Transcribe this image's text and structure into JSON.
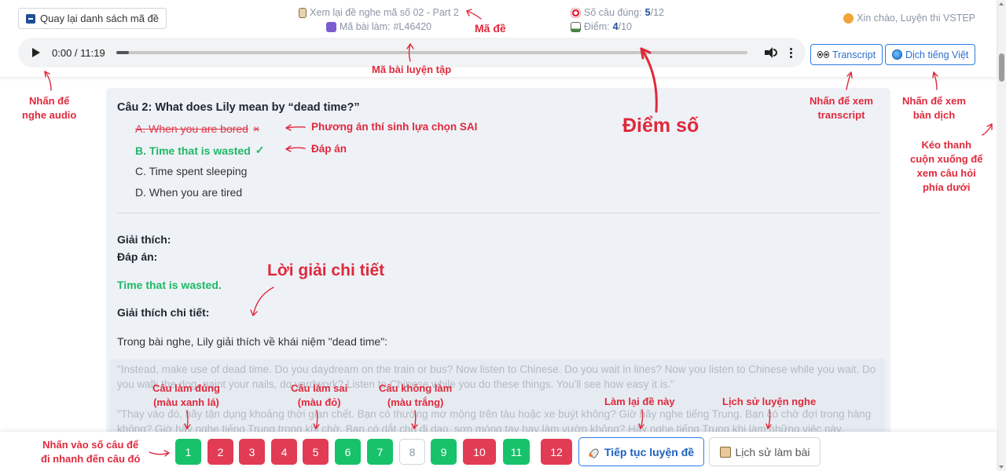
{
  "header": {
    "back_label": "Quay lại danh sách mã đề",
    "exam_title": "Xem lại đề nghe mã số 02 - Part 2",
    "attempt_label": "Mã bài làm:",
    "attempt_code": "#L46420",
    "correct_label": "Số câu đúng:",
    "correct_value": "5",
    "correct_total": "/12",
    "score_label": "Điểm:",
    "score_value": "4",
    "score_total": "/10",
    "greeting": "Xin chào, Luyện thi VSTEP",
    "transcript_label": "Transcript",
    "translate_label": "Dịch tiếng Việt"
  },
  "player": {
    "time": "0:00 / 11:19",
    "progress": 0.02
  },
  "question": {
    "title": "Câu 2: What does Lily mean by “dead time?”",
    "options": [
      {
        "text": "A. When you are bored",
        "status": "wrong"
      },
      {
        "text": "B. Time that is wasted",
        "status": "correct"
      },
      {
        "text": "C. Time spent sleeping",
        "status": "normal"
      },
      {
        "text": "D. When you are tired",
        "status": "normal"
      }
    ],
    "wrong_mark": "×",
    "correct_mark": "✓"
  },
  "explanation": {
    "heading": "Giải thích:",
    "answer_label": "Đáp án:",
    "answer_text": "Time that is wasted.",
    "detail_label": "Giải thích chi tiết:",
    "paragraph": "Trong bài nghe, Lily giải thích về khái niệm \"dead time\":",
    "quote_en": "\"Instead, make use of dead time. Do you daydream on the train or bus? Now listen to Chinese. Do you wait in lines? Now you listen to Chinese while you wait. Do you walk the dog, paint your nails, do yardwork? Listen to Chinese while you do these things. You'll see how easy it is.\"",
    "quote_vi": "\"Thay vào đó, hãy tận dụng khoảng thời gian chết. Bạn có thường mơ mộng trên tàu hoặc xe buýt không? Giờ hãy nghe tiếng Trung. Bạn có chờ đợi trong hàng không? Giờ hãy nghe tiếng Trung trong khi chờ. Bạn có dắt chó đi dạo, sơn móng tay hay làm vườn không? Hãy nghe tiếng Trung khi làm những việc này."
  },
  "bottom": {
    "questions": [
      {
        "n": "1",
        "status": "correct"
      },
      {
        "n": "2",
        "status": "wrong"
      },
      {
        "n": "3",
        "status": "wrong"
      },
      {
        "n": "4",
        "status": "wrong"
      },
      {
        "n": "5",
        "status": "wrong"
      },
      {
        "n": "6",
        "status": "correct"
      },
      {
        "n": "7",
        "status": "correct"
      },
      {
        "n": "8",
        "status": "unanswered"
      },
      {
        "n": "9",
        "status": "correct"
      },
      {
        "n": "10",
        "status": "wrong"
      },
      {
        "n": "11",
        "status": "correct"
      },
      {
        "n": "12",
        "status": "wrong"
      }
    ],
    "continue_label": "Tiếp tục luyện đề",
    "history_label": "Lịch sử làm bài"
  },
  "annotations": {
    "ma_de": "Mã đề",
    "ma_bai": "Mã bài luyện tập",
    "audio": "Nhấn để\nnghe audio",
    "transcript": "Nhấn để xem\ntranscript",
    "translate": "Nhấn để xem\nbản dịch",
    "scroll": "Kéo thanh\ncuộn xuống để\nxem câu hỏi\nphía dưới",
    "wrong_choice": "Phương án thí sinh lựa chọn SAI",
    "answer": "Đáp án",
    "score": "Điểm số",
    "detail": "Lời giải chi tiết",
    "correct_q": "Câu làm đúng\n(màu xanh lá)",
    "wrong_q": "Câu làm sai\n(màu đỏ)",
    "none_q": "Câu không làm\n(màu trắng)",
    "redo": "Làm lại đề này",
    "history": "Lịch sử luyện nghe",
    "jump": "Nhấn vào số câu để\nđi nhanh đến câu đó"
  },
  "colors": {
    "correct": "#17c26b",
    "wrong": "#e23c55",
    "accent": "#2c7be5",
    "annotation": "#e0293c"
  }
}
